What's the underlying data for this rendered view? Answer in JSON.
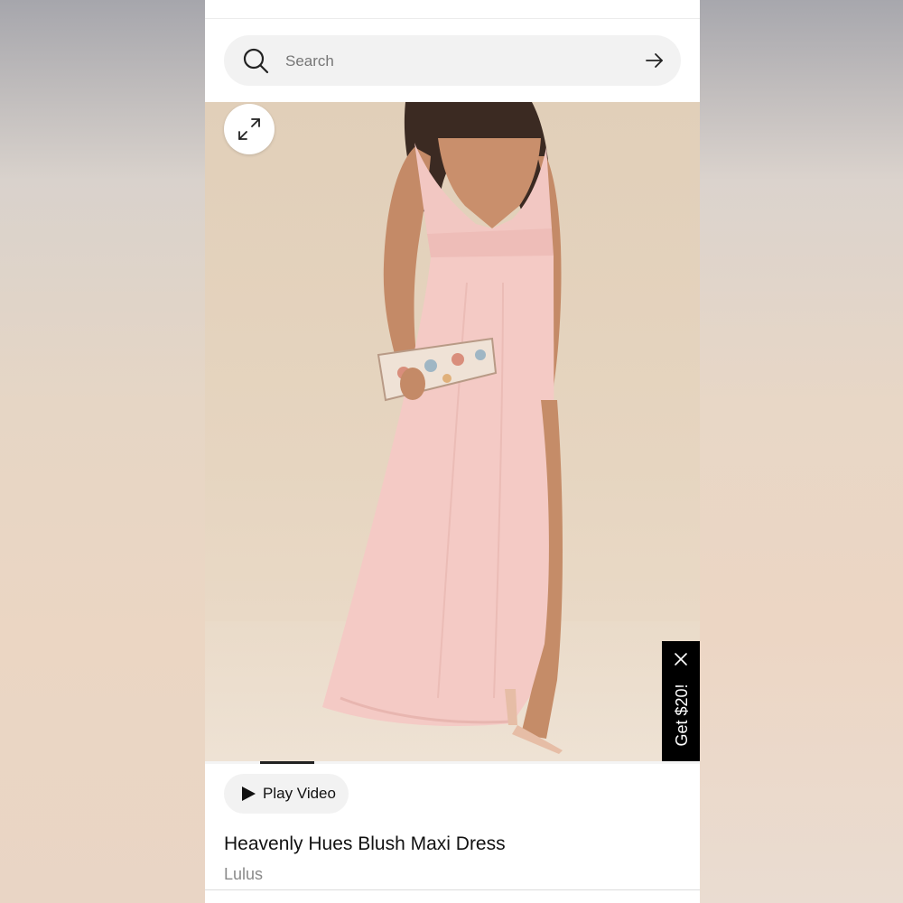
{
  "search": {
    "placeholder": "Search"
  },
  "product": {
    "image_description_icon": "expand-icon",
    "title": "Heavenly Hues Blush Maxi Dress",
    "brand": "Lulus",
    "play_video_label": "Play Video"
  },
  "promo": {
    "label": "Get $20!"
  },
  "colors": {
    "accent_black": "#000000",
    "dress_blush": "#f3c9c6",
    "backdrop_beige": "#e3d1bc"
  }
}
